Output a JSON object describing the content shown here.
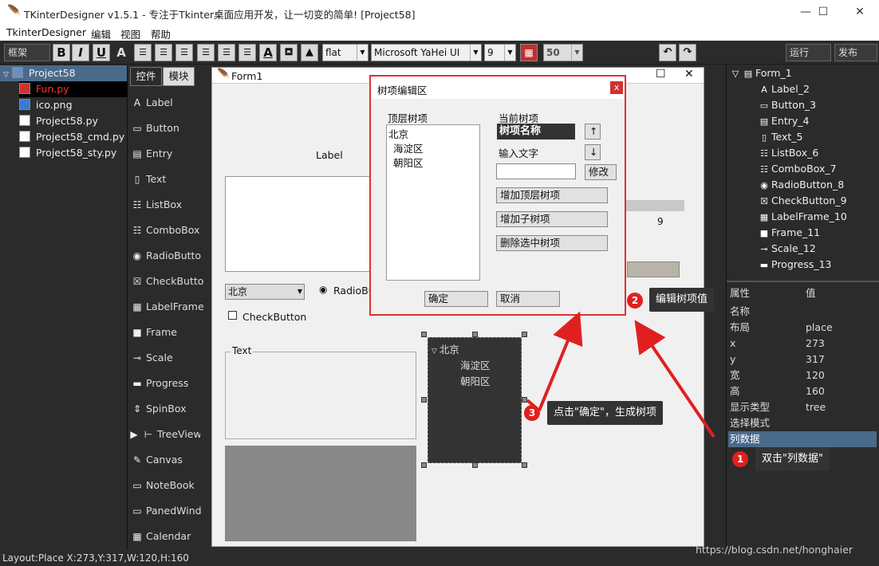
{
  "window": {
    "title": "TKinterDesigner v1.5.1 - 专注于Tkinter桌面应用开发，让一切变的简单!    [Project58]",
    "minimize": "—",
    "maximize": "☐",
    "close": "✕"
  },
  "menu": [
    "TkinterDesigner",
    "编辑",
    "视图",
    "帮助"
  ],
  "toolbar": {
    "frame_label": "框架",
    "relief_value": "flat",
    "font_value": "Microsoft YaHei UI",
    "size_value": "9",
    "num_value": "50",
    "run_label": "运行",
    "publish_label": "发布"
  },
  "project": {
    "name": "Project58",
    "files": [
      "Fun.py",
      "ico.png",
      "Project58.py",
      "Project58_cmd.py",
      "Project58_sty.py"
    ]
  },
  "tool_tabs": [
    "控件",
    "模块"
  ],
  "tools": [
    "Label",
    "Button",
    "Entry",
    "Text",
    "ListBox",
    "ComboBox",
    "RadioButto",
    "CheckButto",
    "LabelFrame",
    "Frame",
    "Scale",
    "Progress",
    "SpinBox",
    "TreeView",
    "Canvas",
    "NoteBook",
    "PanedWind",
    "Calendar"
  ],
  "form": {
    "title": "Form1",
    "label_text": "Label",
    "combo_value": "北京",
    "radio_text": "RadioBu",
    "check_text": "CheckButton",
    "labelframe_text": "Text",
    "scale_value": "9",
    "tree_items": [
      "北京",
      "海淀区",
      "朝阳区"
    ]
  },
  "tree_panel": {
    "root": "Form_1",
    "items": [
      "Label_2",
      "Button_3",
      "Entry_4",
      "Text_5",
      "ListBox_6",
      "ComboBox_7",
      "RadioButton_8",
      "CheckButton_9",
      "LabelFrame_10",
      "Frame_11",
      "Scale_12",
      "Progress_13"
    ]
  },
  "properties": {
    "header_name": "属性",
    "header_value": "值",
    "rows": [
      {
        "name": "名称",
        "value": ""
      },
      {
        "name": "布局",
        "value": "place"
      },
      {
        "name": "x",
        "value": "273"
      },
      {
        "name": "y",
        "value": "317"
      },
      {
        "name": "宽",
        "value": "120"
      },
      {
        "name": "高",
        "value": "160"
      },
      {
        "name": "显示类型",
        "value": "tree"
      },
      {
        "name": "选择模式",
        "value": ""
      },
      {
        "name": "列数据",
        "value": ""
      }
    ]
  },
  "dialog": {
    "title": "树项编辑区",
    "close": "x",
    "top_label": "顶层树项",
    "top_items": [
      "北京",
      "海淀区",
      "朝阳区"
    ],
    "current_label": "当前树项",
    "current_value": "树项名称",
    "up": "↑",
    "down": "↓",
    "input_label": "输入文字",
    "modify": "修改",
    "add_top": "增加顶层树项",
    "add_child": "增加子树项",
    "delete": "删除选中树项",
    "ok": "确定",
    "cancel": "取消"
  },
  "callouts": {
    "c1": {
      "num": "1",
      "text": "双击\"列数据\""
    },
    "c2": {
      "num": "2",
      "text": "编辑树项值"
    },
    "c3": {
      "num": "3",
      "text": "点击\"确定\"，生成树项"
    }
  },
  "status": "Layout:Place  X:273,Y:317,W:120,H:160",
  "watermark": "https://blog.csdn.net/honghaier"
}
